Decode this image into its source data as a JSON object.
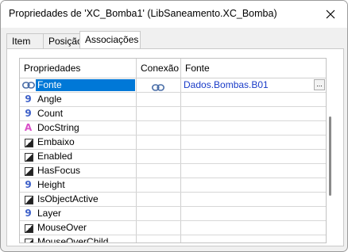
{
  "window": {
    "title": "Propriedades de 'XC_Bomba1' (LibSaneamento.XC_Bomba)",
    "close_icon": "close-x-icon"
  },
  "tabs": [
    {
      "label": "Item",
      "active": false
    },
    {
      "label": "Posição",
      "active": false
    },
    {
      "label": "Associações",
      "active": true
    }
  ],
  "grid": {
    "headers": {
      "propriedades": "Propriedades",
      "conexao": "Conexão",
      "fonte": "Fonte"
    },
    "rows": [
      {
        "icon": "link-icon",
        "name": "Fonte",
        "selected": true,
        "conexao_icon": "link-icon",
        "fonte": "Dados.Bombas.B01",
        "ellipsis": "..."
      },
      {
        "icon": "numeric-icon",
        "name": "Angle",
        "fonte": ""
      },
      {
        "icon": "numeric-icon",
        "name": "Count",
        "fonte": ""
      },
      {
        "icon": "string-icon",
        "name": "DocString",
        "fonte": ""
      },
      {
        "icon": "boolean-icon",
        "name": "Embaixo",
        "fonte": ""
      },
      {
        "icon": "boolean-icon",
        "name": "Enabled",
        "fonte": ""
      },
      {
        "icon": "boolean-icon",
        "name": "HasFocus",
        "fonte": ""
      },
      {
        "icon": "numeric-icon",
        "name": "Height",
        "fonte": ""
      },
      {
        "icon": "boolean-icon",
        "name": "IsObjectActive",
        "fonte": ""
      },
      {
        "icon": "numeric-icon",
        "name": "Layer",
        "fonte": ""
      },
      {
        "icon": "boolean-icon",
        "name": "MouseOver",
        "fonte": ""
      },
      {
        "icon": "boolean-icon",
        "name": "MouseOverChild",
        "fonte": ""
      }
    ]
  },
  "icon_glyphs": {
    "numeric": "9",
    "string": "A"
  },
  "colors": {
    "selection": "#0078d7",
    "link_value": "#1a3cc8",
    "numeric_icon": "#3c5fc8",
    "string_icon": "#d94fc8"
  }
}
